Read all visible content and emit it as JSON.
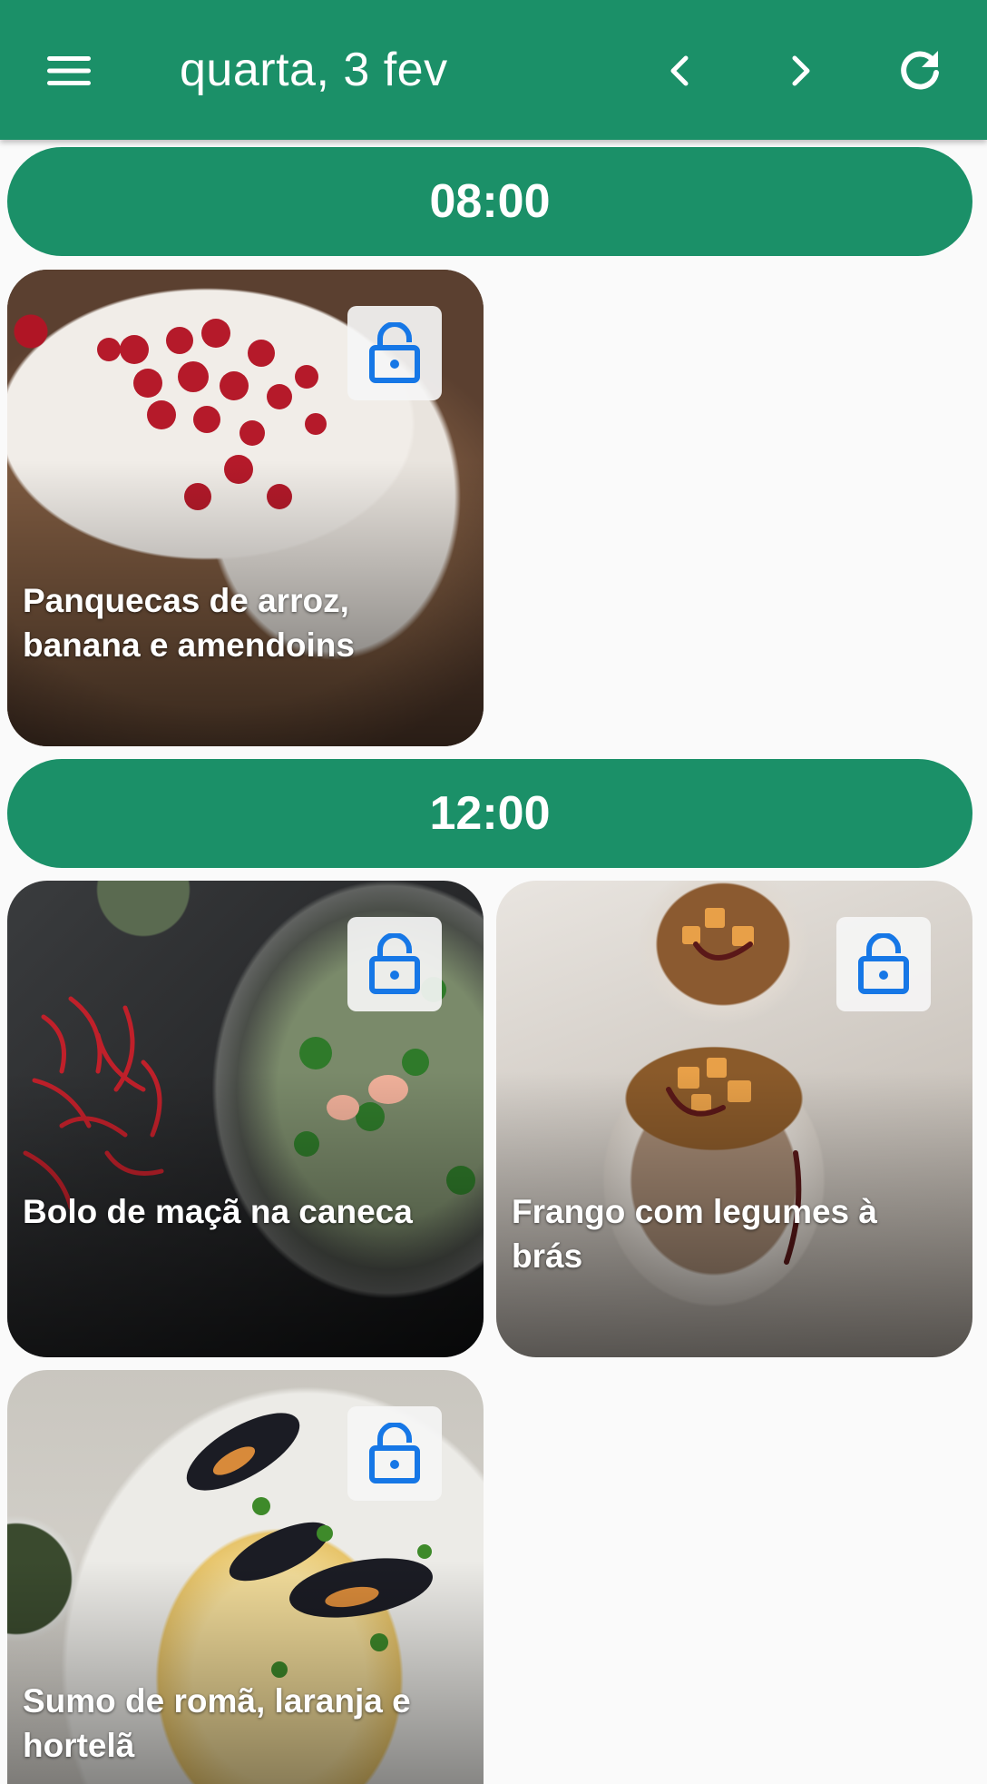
{
  "appbar": {
    "title": "quarta, 3 fev",
    "menu_icon": "menu-icon",
    "prev_icon": "chevron-left-icon",
    "next_icon": "chevron-right-icon",
    "refresh_icon": "refresh-icon"
  },
  "colors": {
    "primary": "#1b9068",
    "lock_icon": "#1677e6",
    "background": "#fafafa"
  },
  "schedule": [
    {
      "time": "08:00",
      "recipes": [
        {
          "name": "Panquecas de arroz, banana e amendoins",
          "icon": "lock-open-icon"
        }
      ]
    },
    {
      "time": "12:00",
      "recipes": [
        {
          "name": "Bolo de maçã na caneca",
          "icon": "lock-open-icon"
        },
        {
          "name": "Frango com legumes à brás",
          "icon": "lock-open-icon"
        },
        {
          "name": "Sumo de romã, laranja e hortelã",
          "icon": "lock-open-icon"
        }
      ]
    }
  ]
}
